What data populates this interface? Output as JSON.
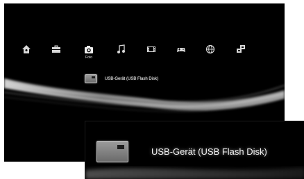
{
  "xmb": {
    "categories": [
      {
        "name": "users",
        "icon": "home-icon"
      },
      {
        "name": "settings",
        "icon": "toolbox-icon"
      },
      {
        "name": "photo",
        "icon": "camera-icon",
        "label": "Foto"
      },
      {
        "name": "music",
        "icon": "music-note-icon"
      },
      {
        "name": "video",
        "icon": "film-strip-icon"
      },
      {
        "name": "game",
        "icon": "gamepad-icon"
      },
      {
        "name": "network",
        "icon": "globe-icon"
      },
      {
        "name": "friends",
        "icon": "friends-icon"
      }
    ],
    "selected_category": "Foto",
    "device": {
      "icon": "usb-device-icon",
      "label": "USB-Gerät (USB Flash Disk)"
    }
  },
  "colors": {
    "background": "#000000",
    "icon": "#d8d8d8",
    "text": "#f2f2f2",
    "page": "#ffffff"
  }
}
